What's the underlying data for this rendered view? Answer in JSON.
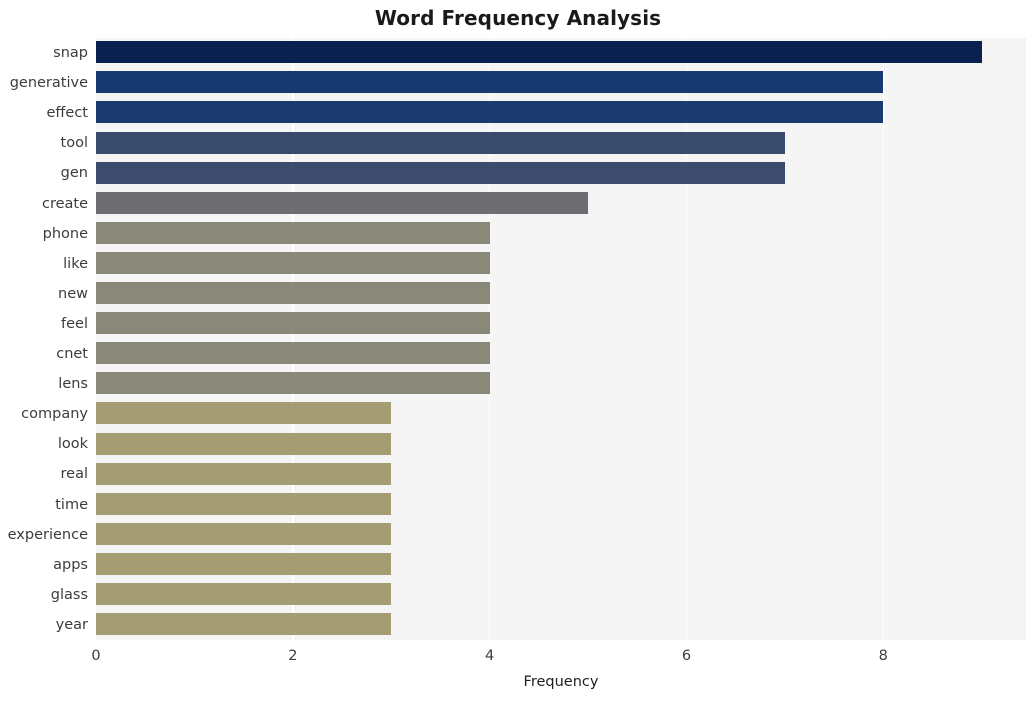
{
  "chart_data": {
    "type": "bar",
    "orientation": "horizontal",
    "title": "Word Frequency Analysis",
    "xlabel": "Frequency",
    "ylabel": "",
    "xlim": [
      0,
      9.45
    ],
    "ylim": [
      0,
      20
    ],
    "grid": true,
    "grid_axis": "x",
    "legend": "none",
    "categories": [
      "snap",
      "generative",
      "effect",
      "tool",
      "gen",
      "create",
      "phone",
      "like",
      "new",
      "feel",
      "cnet",
      "lens",
      "company",
      "look",
      "real",
      "time",
      "experience",
      "apps",
      "glass",
      "year"
    ],
    "values": [
      9,
      8,
      8,
      7,
      7,
      5,
      4,
      4,
      4,
      4,
      4,
      4,
      3,
      3,
      3,
      3,
      3,
      3,
      3,
      3
    ],
    "bar_colors": [
      "#0a2150",
      "#163a70",
      "#1b3a6e",
      "#3a4a6b",
      "#3d4c6d",
      "#6e6e72",
      "#8a8878",
      "#8a8878",
      "#8a8878",
      "#8a8878",
      "#8a8878",
      "#8a8878",
      "#a49c72",
      "#a49c72",
      "#a49c72",
      "#a49c72",
      "#a49c72",
      "#a49c72",
      "#a49c72",
      "#a49c72"
    ],
    "xticks": [
      0,
      2,
      4,
      6,
      8
    ],
    "xtick_labels": [
      "0",
      "2",
      "4",
      "6",
      "8"
    ],
    "plot_background": "#f5f5f6",
    "figure_background": "#ffffff",
    "gridline_color": "#ffffff",
    "tick_label_color": "#3c3c3c",
    "title_color": "#1a1a1a"
  }
}
